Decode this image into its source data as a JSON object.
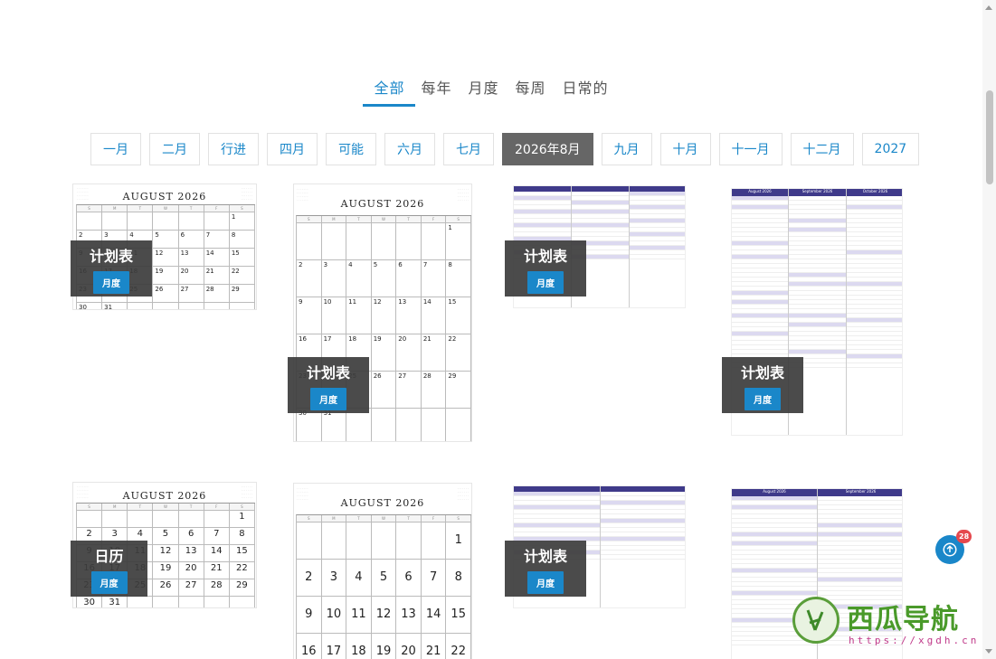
{
  "category_tabs": [
    {
      "label": "全部",
      "active": true
    },
    {
      "label": "每年",
      "active": false
    },
    {
      "label": "月度",
      "active": false
    },
    {
      "label": "每周",
      "active": false
    },
    {
      "label": "日常的",
      "active": false
    }
  ],
  "month_filters": [
    {
      "label": "一月",
      "active": false
    },
    {
      "label": "二月",
      "active": false
    },
    {
      "label": "行进",
      "active": false
    },
    {
      "label": "四月",
      "active": false
    },
    {
      "label": "可能",
      "active": false
    },
    {
      "label": "六月",
      "active": false
    },
    {
      "label": "七月",
      "active": false
    },
    {
      "label": "2026年8月",
      "active": true
    },
    {
      "label": "九月",
      "active": false
    },
    {
      "label": "十月",
      "active": false
    },
    {
      "label": "十一月",
      "active": false
    },
    {
      "label": "十二月",
      "active": false
    },
    {
      "label": "2027",
      "active": false
    }
  ],
  "cards": [
    {
      "overlay_title": "计划表",
      "badge": "月度",
      "thumb_title": "AUGUST 2026",
      "kind": "calendar-landscape"
    },
    {
      "overlay_title": "计划表",
      "badge": "月度",
      "thumb_title": "AUGUST 2026",
      "kind": "calendar-portrait"
    },
    {
      "overlay_title": "计划表",
      "badge": "月度",
      "kind": "planner-3col"
    },
    {
      "overlay_title": "计划表",
      "badge": "月度",
      "kind": "planner-3col-portrait",
      "thumb_months": [
        "August 2026",
        "September 2026",
        "October 2026"
      ]
    },
    {
      "overlay_title": "日历",
      "badge": "月度",
      "thumb_title": "AUGUST 2026",
      "kind": "calendar-landscape-large"
    },
    {
      "overlay_title": "",
      "badge": "",
      "thumb_title": "AUGUST 2026",
      "kind": "calendar-portrait-large"
    },
    {
      "overlay_title": "计划表",
      "badge": "月度",
      "kind": "planner-2col"
    },
    {
      "overlay_title": "",
      "badge": "",
      "kind": "planner-2col-portrait",
      "thumb_months": [
        "August 2026",
        "September 2026"
      ]
    }
  ],
  "floating_badge_count": "28",
  "watermark": {
    "text": "西瓜导航",
    "url": "https://xgdh.cn"
  },
  "colors": {
    "accent": "#1a87c9",
    "overlay": "#3c3c3c",
    "planner_header": "#3f3a8a",
    "badge_red": "#e5484d"
  }
}
